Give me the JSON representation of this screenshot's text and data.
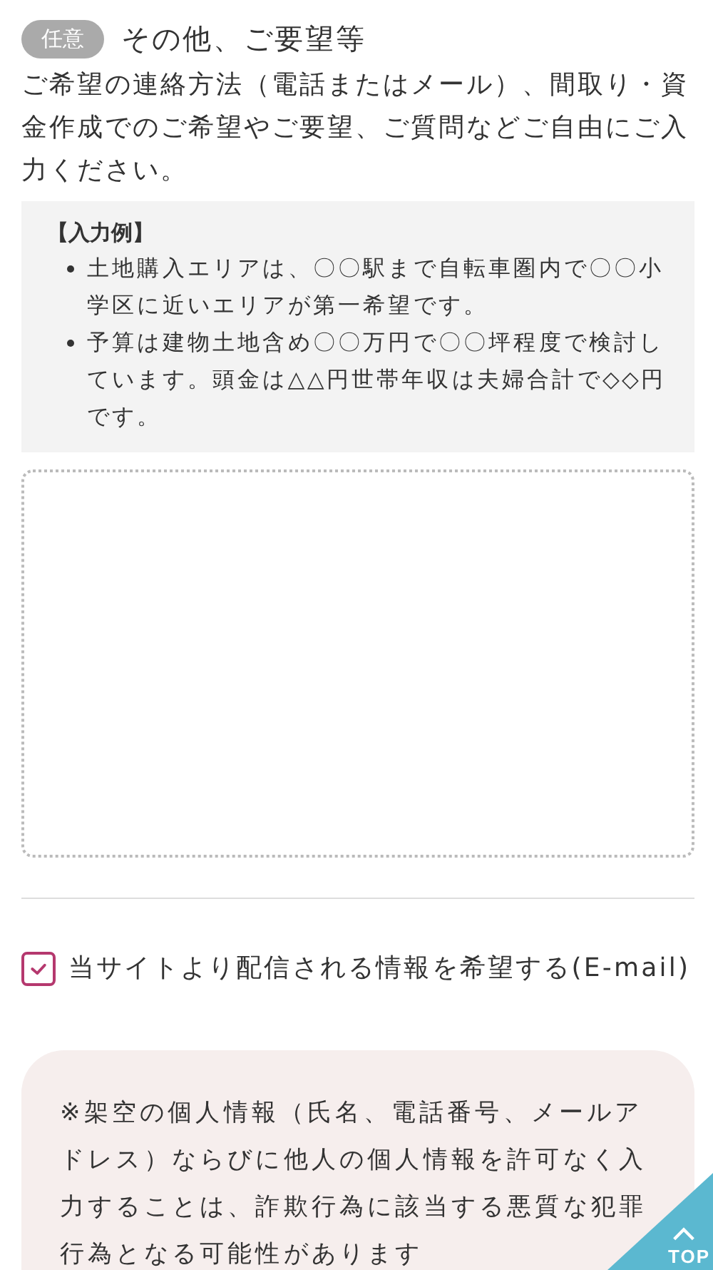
{
  "field": {
    "badge": "任意",
    "title": "その他、ご要望等",
    "description": "ご希望の連絡方法（電話またはメール）、間取り・資金作成でのご希望やご要望、ご質問などご自由にご入力ください。"
  },
  "example": {
    "heading": "【入力例】",
    "items": [
      "土地購入エリアは、〇〇駅まで自転車圏内で〇〇小学区に近いエリアが第一希望です。",
      "予算は建物土地含め〇〇万円で〇〇坪程度で検討しています。頭金は△△円世帯年収は夫婦合計で◇◇円です。"
    ]
  },
  "newsletter": {
    "label": "当サイトより配信される情報を希望する(E-mail)",
    "checked": true
  },
  "notice": {
    "text": "※架空の個人情報（氏名、電話番号、メールアドレス）ならびに他人の個人情報を許可なく入力することは、詐欺行為に該当する悪質な犯罪行為となる可能性があります"
  },
  "top_button": {
    "label": "TOP"
  }
}
